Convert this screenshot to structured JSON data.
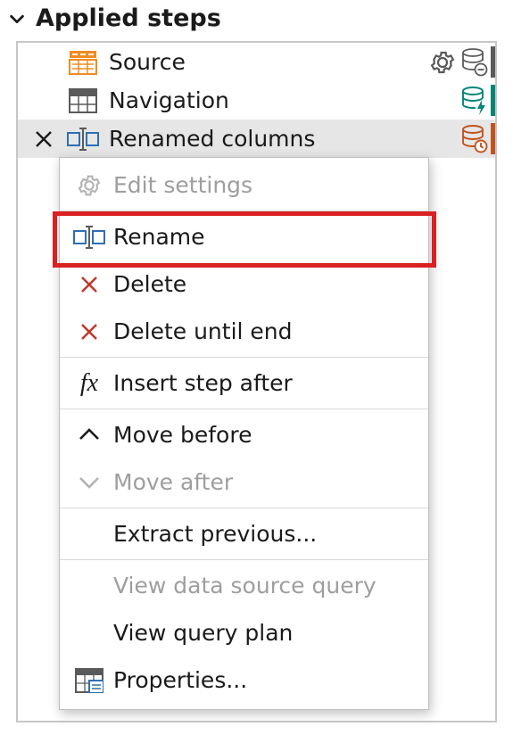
{
  "header": {
    "title": "Applied steps"
  },
  "steps": [
    {
      "label": "Source"
    },
    {
      "label": "Navigation"
    },
    {
      "label": "Renamed columns"
    }
  ],
  "menu": {
    "edit_settings": "Edit settings",
    "rename": "Rename",
    "delete": "Delete",
    "delete_until_end": "Delete until end",
    "insert_step": "Insert step after",
    "move_before": "Move before",
    "move_after": "Move after",
    "extract_prev": "Extract previous...",
    "view_source_q": "View data source query",
    "view_plan": "View query plan",
    "properties": "Properties..."
  }
}
